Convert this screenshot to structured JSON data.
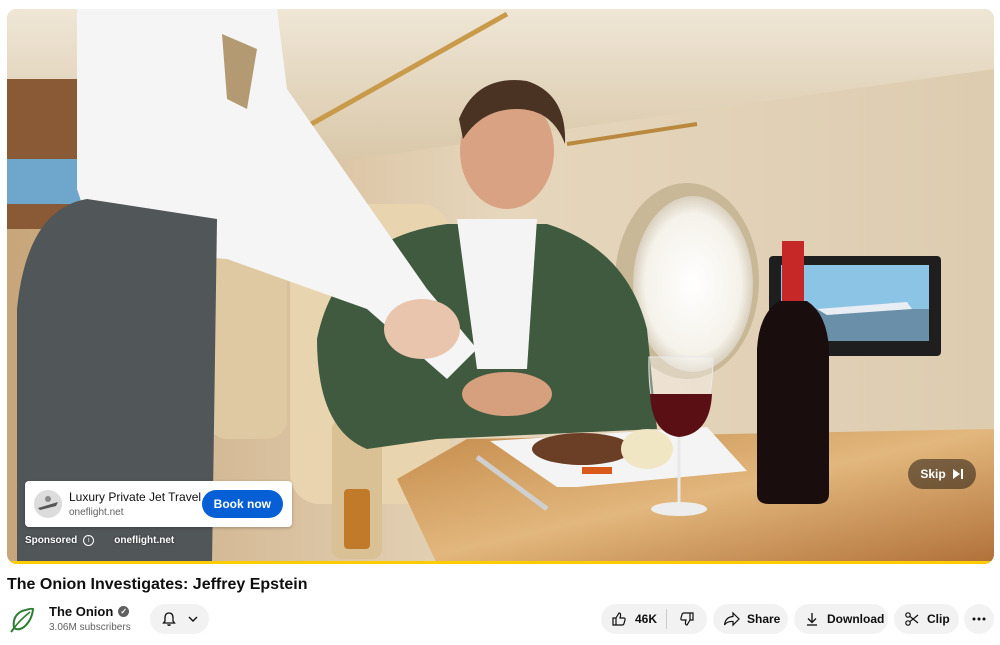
{
  "ad": {
    "title": "Luxury Private Jet Travel",
    "domain": "oneflight.net",
    "cta": "Book now",
    "sponsored_label": "Sponsored",
    "sponsor_domain": "oneflight.net",
    "skip_label": "Skip"
  },
  "player": {
    "progress_fraction": 1.0
  },
  "video": {
    "title": "The Onion Investigates: Jeffrey Epstein"
  },
  "channel": {
    "name": "The Onion",
    "subscribers": "3.06M subscribers"
  },
  "actions": {
    "likes": "46K",
    "share": "Share",
    "download": "Download",
    "clip": "Clip"
  },
  "icons": [
    "bell-icon",
    "chevron-down-icon",
    "thumbs-up-icon",
    "thumbs-down-icon",
    "share-icon",
    "download-icon",
    "scissors-icon",
    "more-icon",
    "verified-icon",
    "info-icon",
    "skip-icon"
  ],
  "colors": {
    "accent_blue": "#065fd4",
    "progress": "#ffcc00",
    "brand_green": "#2e7d32"
  }
}
